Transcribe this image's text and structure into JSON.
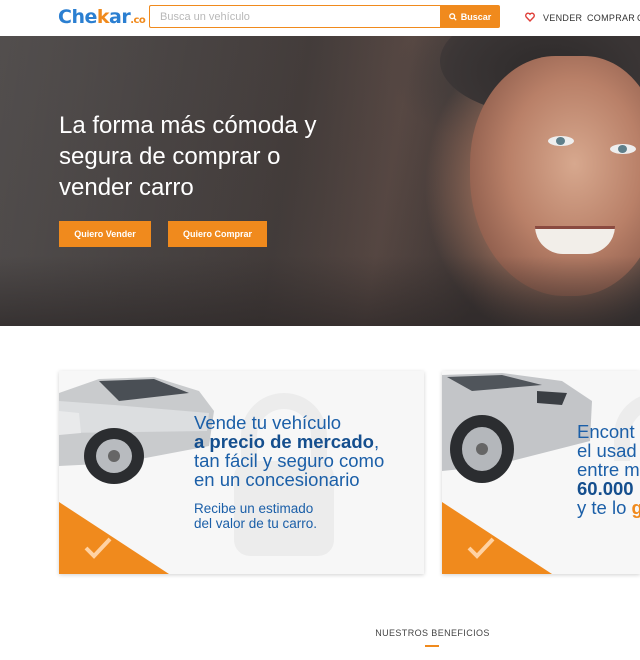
{
  "header": {
    "logo": {
      "part1": "Che",
      "part2": "k",
      "part3": "ar",
      "suffix": ".co"
    },
    "search": {
      "placeholder": "Busca un vehículo",
      "value": ""
    },
    "search_button": "Buscar",
    "nav": {
      "vender": "VENDER",
      "comprar": "COMPRAR",
      "more": "C"
    }
  },
  "hero": {
    "title": "La forma más cómoda y segura de comprar o vender carro",
    "buttons": {
      "vender": "Quiero Vender",
      "comprar": "Quiero Comprar"
    }
  },
  "cards": [
    {
      "title_line1": "Vende tu vehículo",
      "title_bold": "a precio de mercado",
      "title_after_bold": ",",
      "title_line3": "tan fácil y seguro como",
      "title_line4": "en un concesionario",
      "subtitle_line1": "Recibe un estimado",
      "subtitle_line2": "del valor de tu carro."
    },
    {
      "line1": "Encont",
      "line2": "el usad",
      "line3": "entre m",
      "line4_bold": "60.000",
      "line5_prefix": "y te lo ",
      "line5_orange": "g"
    }
  ],
  "benefits": {
    "heading": "NUESTROS BENEFICIOS"
  },
  "colors": {
    "accent": "#f08a1d",
    "brand_blue": "#2b7fd1",
    "card_text": "#1b5fa8"
  }
}
